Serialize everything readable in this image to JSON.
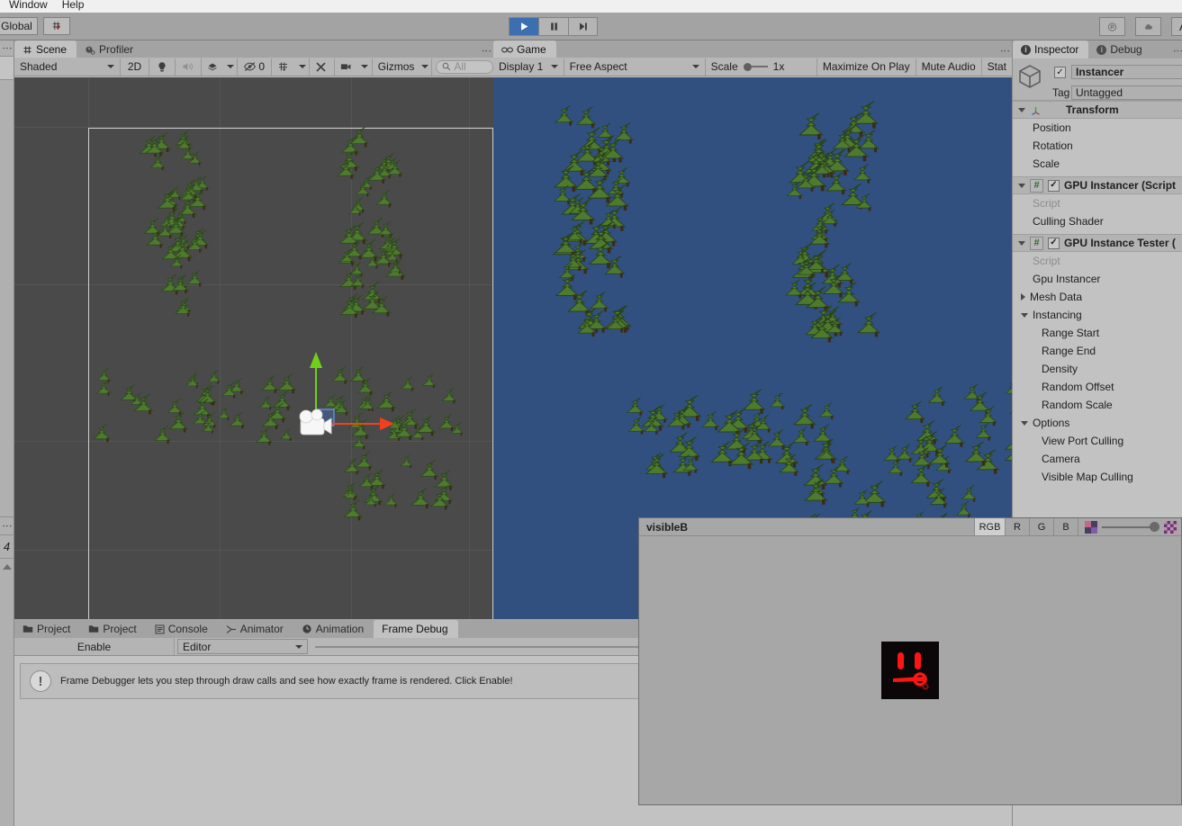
{
  "app": {
    "menubar": [
      "Window",
      "Help"
    ],
    "toolbar": {
      "global_label": "Global",
      "pivot_icon": "grid-snap-icon",
      "play_icon": "play-icon",
      "pause_icon": "pause-icon",
      "step_icon": "step-icon",
      "collab_icon": "collab-icon",
      "cloud_icon": "cloud-icon",
      "account_label": "A"
    }
  },
  "scene_panel": {
    "tabs": [
      {
        "label": "Scene",
        "icon": "scene-grid-icon",
        "active": true
      },
      {
        "label": "Profiler",
        "icon": "profiler-icon",
        "active": false
      }
    ],
    "toolbar": {
      "draw_mode": "Shaded",
      "mode_2d": "2D",
      "lighting_icon": "lightbulb-icon",
      "audio_icon": "audio-icon",
      "fx_icon": "effects-icon",
      "hidden_count": "0",
      "hidden_icon": "eye-off-icon",
      "grid_icon": "grid-visibility-icon",
      "tools_icon": "scene-tools-icon",
      "camera_icon": "scene-camera-icon",
      "gizmos_label": "Gizmos",
      "search_placeholder": "All",
      "search_icon": "search-icon"
    },
    "gizmo": {
      "selected_object": "camera-gizmo",
      "move_handle_y_color": "#6fd116",
      "move_handle_x_color": "#f1411c",
      "move_handle_z_color": "#3b6fd4"
    },
    "background_color": "#4a4a4a"
  },
  "game_panel": {
    "tabs": [
      {
        "label": "Game",
        "icon": "game-icon",
        "active": true
      }
    ],
    "toolbar": {
      "display": "Display 1",
      "aspect": "Free Aspect",
      "scale_label": "Scale",
      "scale_value": "1x",
      "maximize_on_play": "Maximize On Play",
      "mute_audio": "Mute Audio",
      "stats": "Stat"
    },
    "background_color": "#31507f"
  },
  "inspector": {
    "tabs": [
      {
        "label": "Inspector",
        "icon": "info-icon",
        "active": true
      },
      {
        "label": "Debug",
        "icon": "info-icon",
        "active": false
      }
    ],
    "object": {
      "name": "Instancer",
      "enabled": true,
      "icon": "gameobject-cube-icon",
      "tag_label": "Tag",
      "tag_value": "Untagged"
    },
    "components": [
      {
        "title": "Transform",
        "icon": "transform-icon",
        "expanded": true,
        "rows": [
          "Position",
          "Rotation",
          "Scale"
        ]
      },
      {
        "title": "GPU Instancer (Script",
        "icon": "cs-script-icon",
        "enabled": true,
        "expanded": true,
        "rows": [
          "Script",
          "Culling Shader"
        ]
      },
      {
        "title": "GPU Instance Tester (",
        "icon": "cs-script-icon",
        "enabled": true,
        "expanded": true,
        "rows": [
          "Script",
          "Gpu Instancer"
        ]
      }
    ],
    "foldouts": [
      {
        "label": "Mesh Data",
        "expanded": false,
        "children": []
      },
      {
        "label": "Instancing",
        "expanded": true,
        "children": [
          "Range Start",
          "Range End",
          "Density",
          "Random Offset",
          "Random Scale"
        ]
      },
      {
        "label": "Options",
        "expanded": true,
        "children": [
          "View Port Culling",
          "Camera",
          "Visible Map Culling"
        ]
      }
    ]
  },
  "bottom_dock": {
    "tabs": [
      {
        "label": "Project",
        "icon": "folder-icon",
        "active": false
      },
      {
        "label": "Project",
        "icon": "folder-icon",
        "active": false
      },
      {
        "label": "Console",
        "icon": "console-icon",
        "active": false
      },
      {
        "label": "Animator",
        "icon": "animator-icon",
        "active": false
      },
      {
        "label": "Animation",
        "icon": "animation-clock-icon",
        "active": false
      },
      {
        "label": "Frame Debug",
        "icon": "",
        "active": true
      }
    ],
    "frame_debugger": {
      "enable_label": "Enable",
      "target_dropdown": "Editor",
      "slider_value": "0",
      "help_text": "Frame Debugger lets you step through draw calls and see how exactly frame is rendered. Click Enable!",
      "help_icon": "warning-icon"
    }
  },
  "texture_preview": {
    "title": "visibleB",
    "channels": [
      {
        "label": "RGB",
        "active": true
      },
      {
        "label": "R",
        "active": false
      },
      {
        "label": "G",
        "active": false
      },
      {
        "label": "B",
        "active": false
      }
    ],
    "mip_small_icon": "checker-small-icon",
    "mip_large_icon": "checker-large-icon",
    "background_color": "#a7a7a7",
    "texture_bg": "#0b0607",
    "texture_fg": "#ff1414"
  },
  "left_stub": {
    "label": "4"
  }
}
